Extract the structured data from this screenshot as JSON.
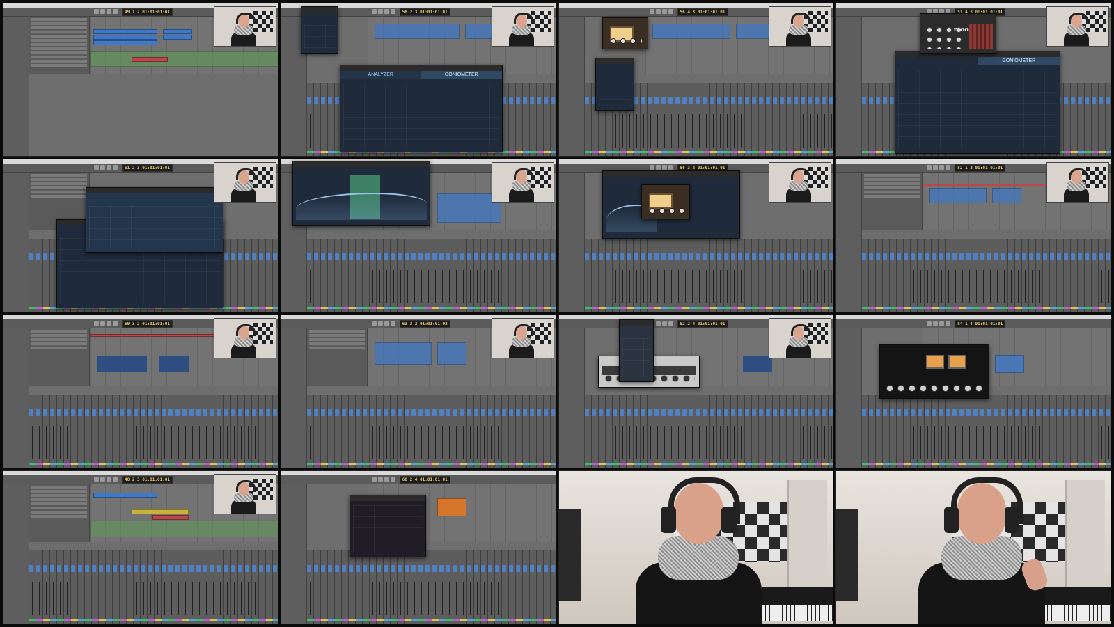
{
  "sheet": {
    "label": "video-contact-sheet"
  },
  "tiles": [
    {
      "type": "daw",
      "lcd": "49 1 2  01:01:01:01",
      "plugin": null,
      "regions": "many"
    },
    {
      "type": "daw",
      "lcd": "58 2 3  01:01:01:01",
      "plugin": {
        "kind": "analyzer",
        "tabs": [
          "ANALYZER",
          "GONIOMETER"
        ]
      }
    },
    {
      "type": "daw",
      "lcd": "56 4 3  01:01:01:01",
      "plugin": {
        "kind": "vintage"
      }
    },
    {
      "type": "daw",
      "lcd": "51 4 3  01:01:01:01",
      "plugin": {
        "kind": "synth",
        "brand": "moog",
        "tab": "GONIOMETER"
      }
    },
    {
      "type": "daw",
      "lcd": "51 2 3  01:01:01:01",
      "plugin": {
        "kind": "analyzer-eq"
      }
    },
    {
      "type": "daw",
      "lcd": "",
      "plugin": {
        "kind": "eq"
      }
    },
    {
      "type": "daw",
      "lcd": "50 3 2  01:01:01:01",
      "plugin": {
        "kind": "eq-vintage"
      }
    },
    {
      "type": "daw",
      "lcd": "52 1 3  01:01:01:01",
      "plugin": null
    },
    {
      "type": "daw",
      "lcd": "59 3 2  01:01:01:01",
      "plugin": null
    },
    {
      "type": "daw",
      "lcd": "63 3 2  01:01:01:02",
      "plugin": null
    },
    {
      "type": "daw",
      "lcd": "52 2 4  01:01:01:01",
      "plugin": {
        "kind": "gray"
      }
    },
    {
      "type": "daw",
      "lcd": "54 1 4  01:01:01:01",
      "plugin": {
        "kind": "compressor"
      }
    },
    {
      "type": "daw",
      "lcd": "40 2 3  01:01:01:01",
      "plugin": null
    },
    {
      "type": "daw",
      "lcd": "60 2 4  01:01:01:01",
      "plugin": {
        "kind": "dark"
      }
    },
    {
      "type": "webcam",
      "pose": "center"
    },
    {
      "type": "webcam",
      "pose": "gesture"
    }
  ]
}
